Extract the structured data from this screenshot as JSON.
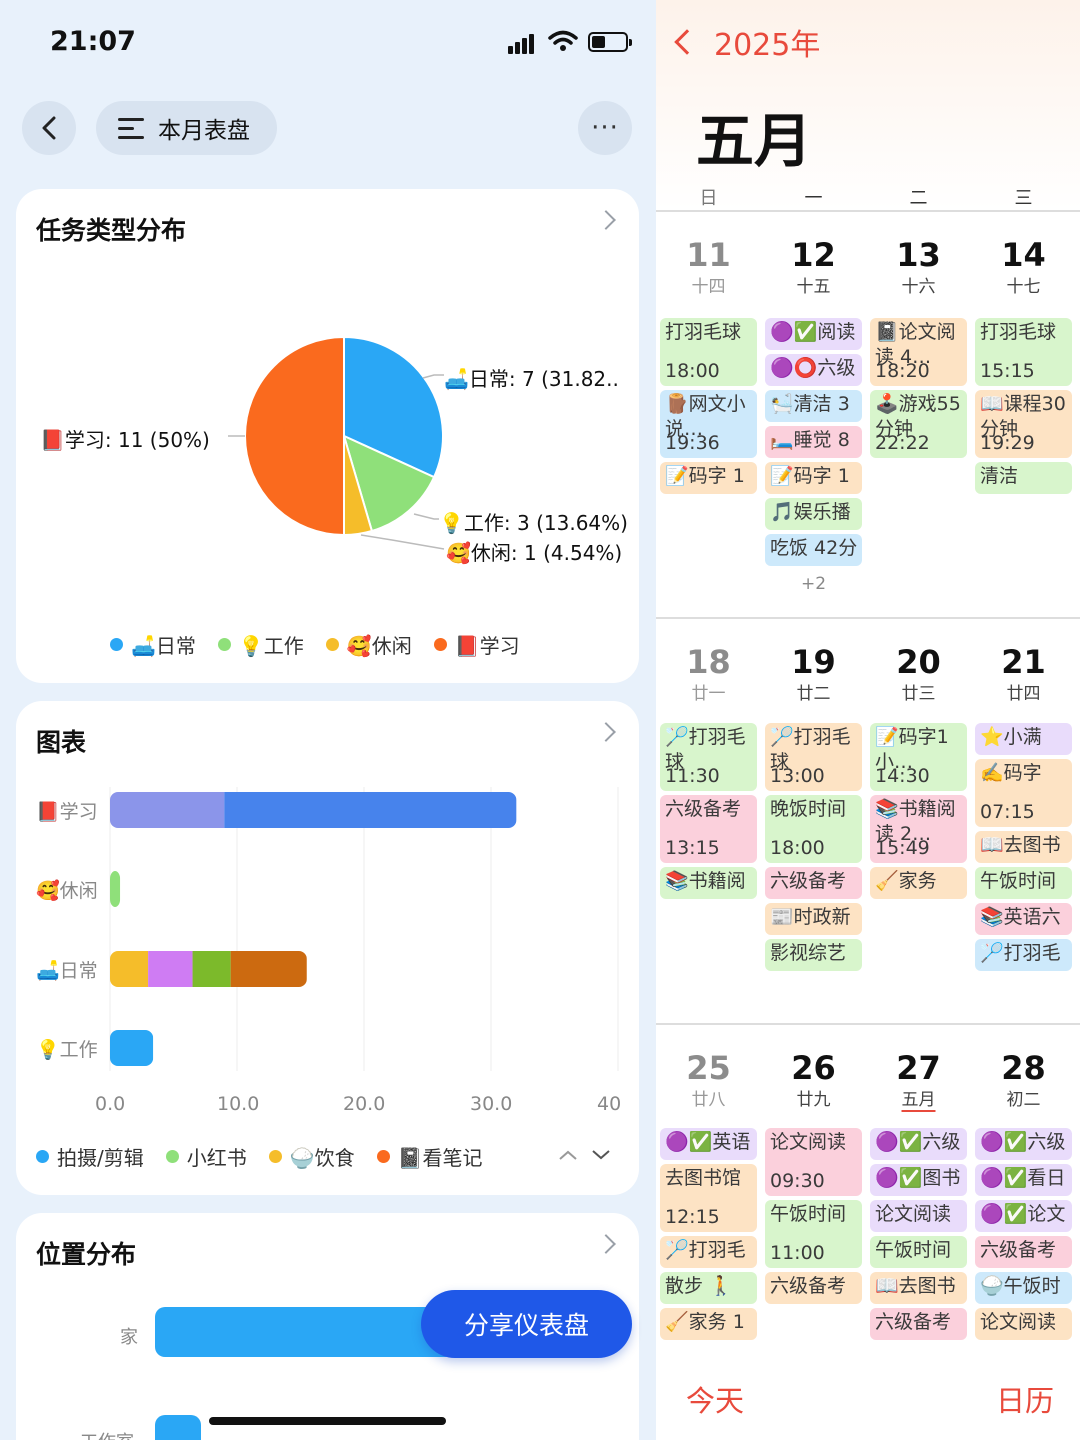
{
  "status": {
    "time": "21:07"
  },
  "header": {
    "title": "本月表盘",
    "more": "···"
  },
  "pie_card": {
    "title": "任务类型分布",
    "labels": {
      "daily": "🛋️日常: 7 (31.82..",
      "study": "📕学习: 11 (50%)",
      "work": "💡工作: 3 (13.64%)",
      "leisure": "🥰休闲: 1 (4.54%)"
    },
    "legend": [
      {
        "label": "🛋️日常",
        "color": "#2aa7f5"
      },
      {
        "label": "💡工作",
        "color": "#8fe07a"
      },
      {
        "label": "🥰休闲",
        "color": "#f5bd2a"
      },
      {
        "label": "📕学习",
        "color": "#fa6a1e"
      }
    ]
  },
  "bar_card": {
    "title": "图表",
    "ticks": [
      "0.0",
      "10.0",
      "20.0",
      "30.0",
      "40"
    ],
    "legend": [
      {
        "label": "拍摄/剪辑",
        "color": "#2aa7f5"
      },
      {
        "label": "小红书",
        "color": "#8fe07a"
      },
      {
        "label": "🍚饮食",
        "color": "#f5bd2a"
      },
      {
        "label": "📓看笔记",
        "color": "#fa6a1e"
      }
    ]
  },
  "loc_card": {
    "title": "位置分布",
    "cat1": "家",
    "cat2": "工作室"
  },
  "share_button": "分享仪表盘",
  "chart_data": [
    {
      "type": "pie",
      "title": "任务类型分布",
      "categories": [
        "🛋️日常",
        "💡工作",
        "🥰休闲",
        "📕学习"
      ],
      "values": [
        7,
        3,
        1,
        11
      ],
      "colors": [
        "#2aa7f5",
        "#8fe07a",
        "#f5bd2a",
        "#fa6a1e"
      ]
    },
    {
      "type": "bar",
      "title": "图表",
      "orientation": "horizontal-stacked",
      "categories": [
        "📕学习",
        "🥰休闲",
        "🛋️日常",
        "💡工作"
      ],
      "xlim": [
        0,
        40
      ],
      "segments": [
        [
          {
            "value": 9,
            "color": "#8b95ea"
          },
          {
            "value": 23,
            "color": "#4783ec"
          }
        ],
        [
          {
            "value": 0.8,
            "color": "#8fe07a"
          }
        ],
        [
          {
            "value": 3,
            "color": "#f5bd2a"
          },
          {
            "value": 3.5,
            "color": "#cf7cf3"
          },
          {
            "value": 3,
            "color": "#7cba2b"
          },
          {
            "value": 6,
            "color": "#cc6a10"
          }
        ],
        [
          {
            "value": 3.4,
            "color": "#2aa7f5"
          }
        ]
      ]
    },
    {
      "type": "bar",
      "title": "位置分布",
      "orientation": "horizontal",
      "categories": [
        "家",
        "工作室"
      ],
      "values": [
        null,
        null
      ]
    }
  ],
  "calendar": {
    "year": "2025年",
    "month": "五月",
    "weekdays": [
      "日",
      "一",
      "二",
      "三"
    ],
    "more_label": "+2",
    "today": "今天",
    "calendar": "日历",
    "weeks": [
      {
        "days": [
          {
            "num": "11",
            "lunar": "十四"
          },
          {
            "num": "12",
            "lunar": "十五"
          },
          {
            "num": "13",
            "lunar": "十六"
          },
          {
            "num": "14",
            "lunar": "十七"
          }
        ],
        "events": [
          {
            "col": 0,
            "row": 0,
            "h": 2,
            "text": "打羽毛球",
            "time": "18:00",
            "bg": "#d8f5cc"
          },
          {
            "col": 0,
            "row": 2,
            "h": 2,
            "text": "🪵网文小说…",
            "time": "19:36",
            "bg": "#cde9fb"
          },
          {
            "col": 0,
            "row": 4,
            "h": 1,
            "text": "📝码字 1",
            "bg": "#fde3c4"
          },
          {
            "col": 1,
            "row": 0,
            "h": 1,
            "text": "🟣✅阅读",
            "bg": "#e9dcfb"
          },
          {
            "col": 1,
            "row": 1,
            "h": 1,
            "text": "🟣⭕六级",
            "bg": "#e9dcfb"
          },
          {
            "col": 1,
            "row": 2,
            "h": 1,
            "text": "🛀清洁 3",
            "bg": "#cde9fb"
          },
          {
            "col": 1,
            "row": 3,
            "h": 1,
            "text": "🛏️睡觉 8",
            "bg": "#fbd0dc"
          },
          {
            "col": 1,
            "row": 4,
            "h": 1,
            "text": "📝码字 1",
            "bg": "#fde3c4"
          },
          {
            "col": 1,
            "row": 5,
            "h": 1,
            "text": "🎵娱乐播",
            "bg": "#d8f5cc"
          },
          {
            "col": 1,
            "row": 6,
            "h": 1,
            "text": "吃饭 42分",
            "bg": "#cde9fb"
          },
          {
            "col": 2,
            "row": 0,
            "h": 2,
            "text": "📓论文阅读 4…",
            "time": "18:20",
            "bg": "#fde3c4"
          },
          {
            "col": 2,
            "row": 2,
            "h": 2,
            "text": "🕹️游戏55分钟",
            "time": "22:22",
            "bg": "#d8f5cc"
          },
          {
            "col": 3,
            "row": 0,
            "h": 2,
            "text": "打羽毛球",
            "time": "15:15",
            "bg": "#d8f5cc"
          },
          {
            "col": 3,
            "row": 2,
            "h": 2,
            "text": "📖课程30分钟",
            "time": "19:29",
            "bg": "#fde3c4"
          },
          {
            "col": 3,
            "row": 4,
            "h": 1,
            "text": "清洁",
            "bg": "#d8f5cc"
          }
        ]
      },
      {
        "days": [
          {
            "num": "18",
            "lunar": "廿一"
          },
          {
            "num": "19",
            "lunar": "廿二"
          },
          {
            "num": "20",
            "lunar": "廿三"
          },
          {
            "num": "21",
            "lunar": "廿四"
          }
        ],
        "events": [
          {
            "col": 0,
            "row": 0,
            "h": 2,
            "text": "🏸打羽毛球",
            "time": "11:30",
            "bg": "#d8f5cc"
          },
          {
            "col": 0,
            "row": 2,
            "h": 2,
            "text": "六级备考",
            "time": "13:15",
            "bg": "#fbd0dc"
          },
          {
            "col": 0,
            "row": 4,
            "h": 1,
            "text": "📚书籍阅",
            "bg": "#d8f5cc"
          },
          {
            "col": 1,
            "row": 0,
            "h": 2,
            "text": "🏸打羽毛球",
            "time": "13:00",
            "bg": "#fde3c4"
          },
          {
            "col": 1,
            "row": 2,
            "h": 2,
            "text": "晚饭时间",
            "time": "18:00",
            "bg": "#d8f5cc"
          },
          {
            "col": 1,
            "row": 4,
            "h": 1,
            "text": "六级备考",
            "bg": "#fbd0dc"
          },
          {
            "col": 1,
            "row": 5,
            "h": 1,
            "text": "📰时政新",
            "bg": "#fde3c4"
          },
          {
            "col": 1,
            "row": 6,
            "h": 1,
            "text": "影视综艺",
            "bg": "#d8f5cc"
          },
          {
            "col": 2,
            "row": 0,
            "h": 2,
            "text": "📝码字1小…",
            "time": "14:30",
            "bg": "#d8f5cc"
          },
          {
            "col": 2,
            "row": 2,
            "h": 2,
            "text": "📚书籍阅读 2…",
            "time": "15:49",
            "bg": "#fbd0dc"
          },
          {
            "col": 2,
            "row": 4,
            "h": 1,
            "text": "🧹家务",
            "bg": "#fde3c4"
          },
          {
            "col": 3,
            "row": 0,
            "h": 1,
            "text": "⭐小满",
            "bg": "#e9dcfb"
          },
          {
            "col": 3,
            "row": 1,
            "h": 2,
            "text": "✍️码字",
            "time": "07:15",
            "bg": "#fde3c4"
          },
          {
            "col": 3,
            "row": 3,
            "h": 1,
            "text": "📖去图书",
            "bg": "#fde3c4"
          },
          {
            "col": 3,
            "row": 4,
            "h": 1,
            "text": "午饭时间",
            "bg": "#d8f5cc"
          },
          {
            "col": 3,
            "row": 5,
            "h": 1,
            "text": "📚英语六",
            "bg": "#fbd0dc"
          },
          {
            "col": 3,
            "row": 6,
            "h": 1,
            "text": "🏸打羽毛",
            "bg": "#cde9fb"
          }
        ]
      },
      {
        "days": [
          {
            "num": "25",
            "lunar": "廿八"
          },
          {
            "num": "26",
            "lunar": "廿九"
          },
          {
            "num": "27",
            "lunar": "五月"
          },
          {
            "num": "28",
            "lunar": "初二"
          }
        ],
        "events": [
          {
            "col": 0,
            "row": 0,
            "h": 1,
            "text": "🟣✅英语",
            "bg": "#e9dcfb"
          },
          {
            "col": 0,
            "row": 1,
            "h": 2,
            "text": "去图书馆",
            "time": "12:15",
            "bg": "#fde3c4"
          },
          {
            "col": 0,
            "row": 3,
            "h": 1,
            "text": "🏸打羽毛",
            "bg": "#fde3c4"
          },
          {
            "col": 0,
            "row": 4,
            "h": 1,
            "text": "散步 🚶",
            "bg": "#d8f5cc"
          },
          {
            "col": 0,
            "row": 5,
            "h": 1,
            "text": "🧹家务 1",
            "bg": "#fde3c4"
          },
          {
            "col": 1,
            "row": 0,
            "h": 2,
            "text": "论文阅读",
            "time": "09:30",
            "bg": "#fbd0dc"
          },
          {
            "col": 1,
            "row": 2,
            "h": 2,
            "text": "午饭时间",
            "time": "11:00",
            "bg": "#d8f5cc"
          },
          {
            "col": 1,
            "row": 4,
            "h": 1,
            "text": "六级备考",
            "bg": "#fde3c4"
          },
          {
            "col": 2,
            "row": 0,
            "h": 1,
            "text": "🟣✅六级",
            "bg": "#e9dcfb"
          },
          {
            "col": 2,
            "row": 1,
            "h": 1,
            "text": "🟣✅图书",
            "bg": "#e9dcfb"
          },
          {
            "col": 2,
            "row": 2,
            "h": 1,
            "text": "论文阅读",
            "bg": "#e9dcfb"
          },
          {
            "col": 2,
            "row": 3,
            "h": 1,
            "text": "午饭时间",
            "bg": "#d8f5cc"
          },
          {
            "col": 2,
            "row": 4,
            "h": 1,
            "text": "📖去图书",
            "bg": "#fde3c4"
          },
          {
            "col": 2,
            "row": 5,
            "h": 1,
            "text": "六级备考",
            "bg": "#fbd0dc"
          },
          {
            "col": 3,
            "row": 0,
            "h": 1,
            "text": "🟣✅六级",
            "bg": "#e9dcfb"
          },
          {
            "col": 3,
            "row": 1,
            "h": 1,
            "text": "🟣✅看日",
            "bg": "#e9dcfb"
          },
          {
            "col": 3,
            "row": 2,
            "h": 1,
            "text": "🟣✅论文",
            "bg": "#e9dcfb"
          },
          {
            "col": 3,
            "row": 3,
            "h": 1,
            "text": "六级备考",
            "bg": "#fbd0dc"
          },
          {
            "col": 3,
            "row": 4,
            "h": 1,
            "text": "🍚午饭时",
            "bg": "#cde9fb"
          },
          {
            "col": 3,
            "row": 5,
            "h": 1,
            "text": "论文阅读",
            "bg": "#fde3c4"
          }
        ]
      }
    ]
  }
}
